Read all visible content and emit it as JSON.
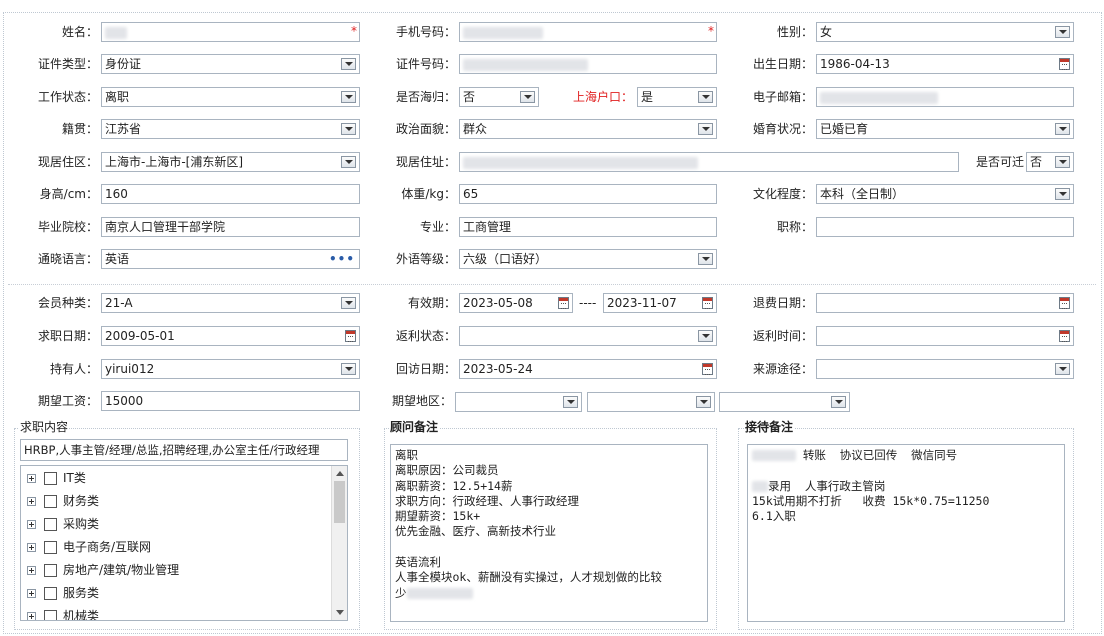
{
  "basic": {
    "name": {
      "label": "姓名："
    },
    "phone": {
      "label": "手机号码："
    },
    "gender": {
      "label": "性别：",
      "value": "女"
    },
    "id_type": {
      "label": "证件类型：",
      "value": "身份证"
    },
    "id_number": {
      "label": "证件号码："
    },
    "birth_date": {
      "label": "出生日期：",
      "value": "1986-04-13"
    },
    "work_status": {
      "label": "工作状态：",
      "value": "离职"
    },
    "returnee": {
      "label": "是否海归：",
      "value": "否"
    },
    "shanghai_hukou": {
      "label": "上海户口：",
      "value": "是"
    },
    "email": {
      "label": "电子邮箱："
    },
    "native_place": {
      "label": "籍贯：",
      "value": "江苏省"
    },
    "political": {
      "label": "政治面貌：",
      "value": "群众"
    },
    "marital": {
      "label": "婚育状况：",
      "value": "已婚已育"
    },
    "current_area": {
      "label": "现居住区：",
      "value": "上海市-上海市-[浦东新区]"
    },
    "current_address": {
      "label": "现居住址："
    },
    "relocate": {
      "label": "是否可迁",
      "value": "否"
    },
    "height": {
      "label": "身高/cm：",
      "value": "160"
    },
    "weight": {
      "label": "体重/kg：",
      "value": "65"
    },
    "education": {
      "label": "文化程度：",
      "value": "本科（全日制）"
    },
    "school": {
      "label": "毕业院校：",
      "value": "南京人口管理干部学院"
    },
    "major": {
      "label": "专业：",
      "value": "工商管理"
    },
    "title": {
      "label": "职称：",
      "value": ""
    },
    "language": {
      "label": "通晓语言：",
      "value": "英语"
    },
    "language_level": {
      "label": "外语等级：",
      "value": "六级（口语好）"
    }
  },
  "member": {
    "type": {
      "label": "会员种类：",
      "value": "21-A"
    },
    "validity": {
      "label": "有效期：",
      "start": "2023-05-08",
      "sep": "----",
      "end": "2023-11-07"
    },
    "refund_date": {
      "label": "退费日期：",
      "value": ""
    },
    "job_date": {
      "label": "求职日期：",
      "value": "2009-05-01"
    },
    "rebate_status": {
      "label": "返利状态：",
      "value": ""
    },
    "rebate_time": {
      "label": "返利时间：",
      "value": ""
    },
    "holder": {
      "label": "持有人：",
      "value": "yirui012"
    },
    "visit_date": {
      "label": "回访日期：",
      "value": "2023-05-24"
    },
    "source": {
      "label": "来源途径：",
      "value": ""
    },
    "salary": {
      "label": "期望工资：",
      "value": "15000"
    },
    "region": {
      "label": "期望地区："
    }
  },
  "job_intent": {
    "title": "求职内容",
    "summary": "HRBP,人事主管/经理/总监,招聘经理,办公室主任/行政经理",
    "categories": [
      "IT类",
      "财务类",
      "采购类",
      "电子商务/互联网",
      "房地产/建筑/物业管理",
      "服务类",
      "机械类"
    ]
  },
  "consultant_notes": {
    "title": "顾问备注",
    "lines": [
      "离职",
      "离职原因：公司裁员",
      "离职薪资：12.5+14薪",
      "求职方向：行政经理、人事行政经理",
      "期望薪资：15k+",
      "优先金融、医疗、高新技术行业",
      "",
      "英语流利",
      "人事全模块ok、薪酬没有实操过，人才规划做的比较",
      "少"
    ]
  },
  "reception_notes": {
    "title": "接待备注",
    "line1": " 转账  协议已回传  微信同号",
    "line2": "录用  人事行政主管岗",
    "line3": "15k试用期不打折   收费 15k*0.75=11250",
    "line4": "6.1入职"
  }
}
